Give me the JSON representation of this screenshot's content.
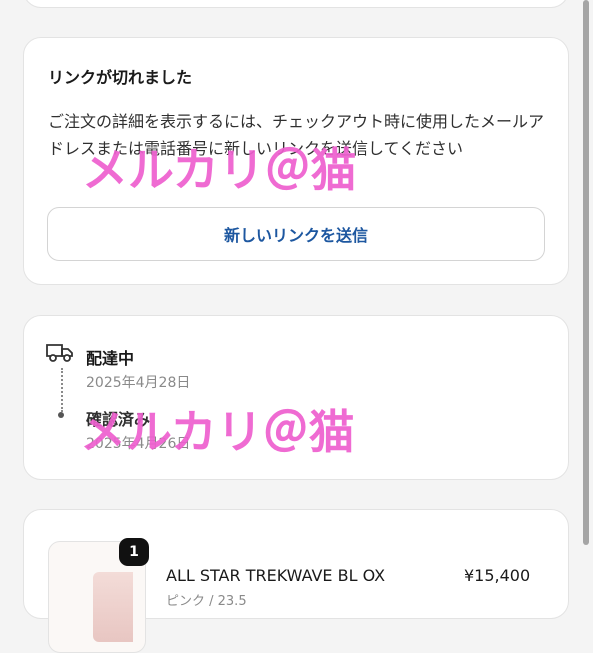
{
  "link_expired": {
    "title": "リンクが切れました",
    "body": "ご注文の詳細を表示するには、チェックアウト時に使用したメールアドレスまたは電話番号に新しいリンクを送信してください",
    "send_button_label": "新しいリンクを送信"
  },
  "delivery": {
    "status_icon": "truck-icon",
    "status_label": "配達中",
    "status_date": "2025年4月28日",
    "confirmed_label": "確認済み",
    "confirmed_date": "2025年4月26日"
  },
  "order": {
    "items": [
      {
        "quantity": "1",
        "name": "ALL STAR TREKWAVE BL OX",
        "price": "¥15,400",
        "variant": "ピンク / 23.5"
      }
    ]
  },
  "watermarks": [
    "メルカリ＠猫",
    "メルカリ＠猫"
  ],
  "colors": {
    "accent_link": "#1d57a0",
    "watermark": "#ee5fcf",
    "page_background": "#f4f4f4"
  }
}
